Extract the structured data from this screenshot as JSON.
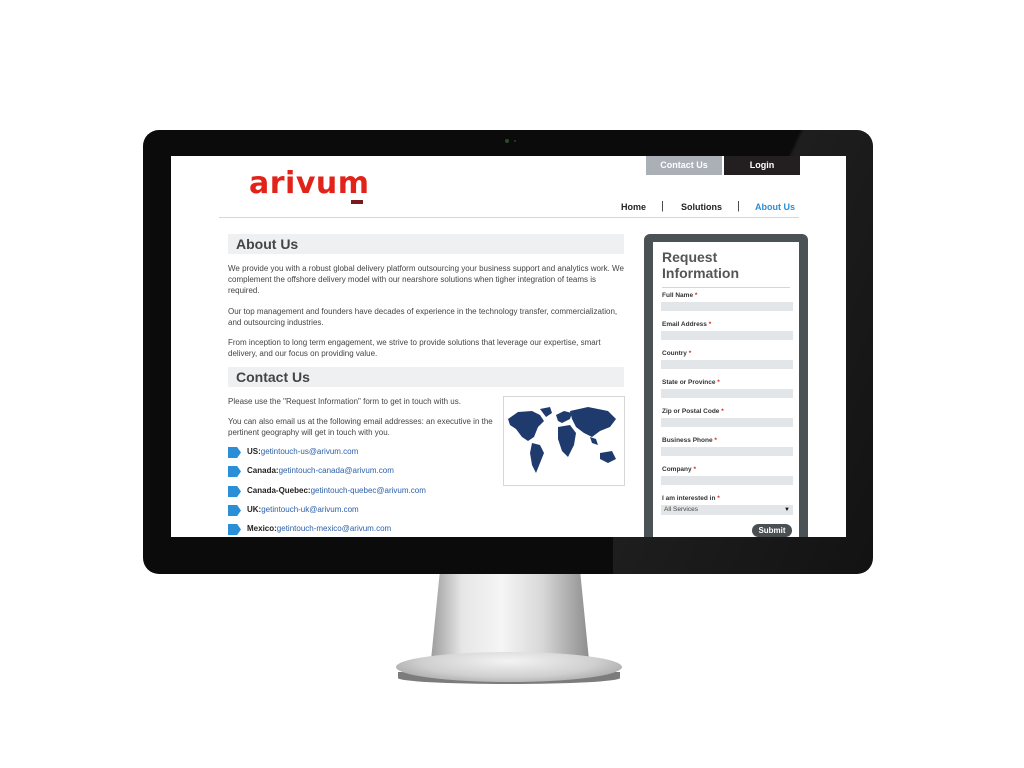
{
  "header": {
    "logo": "arivum",
    "contact_button": "Contact Us",
    "login_button": "Login",
    "nav": [
      {
        "label": "Home"
      },
      {
        "label": "Solutions"
      },
      {
        "label": "About Us"
      }
    ],
    "nav_separator": "|"
  },
  "about": {
    "title": "About Us",
    "paragraphs": [
      "We provide you with a robust global delivery platform outsourcing your business support and analytics work. We complement the offshore delivery model with our nearshore solutions when tigher integration of teams is required.",
      "Our top management and founders have decades of experience in the technology transfer, commercialization, and outsourcing industries.",
      "From inception to long term engagement, we strive to provide solutions that leverage our expertise, smart delivery, and our focus on providing value."
    ]
  },
  "contact": {
    "title": "Contact Us",
    "paragraphs": [
      "Please use the \"Request Information\" form to get in touch with us.",
      "You can also email us at the following email addresses: an executive in the pertinent geography will get in touch with you."
    ],
    "emails": [
      {
        "region": "US:",
        "email": "getintouch-us@arivum.com"
      },
      {
        "region": "Canada:",
        "email": "getintouch-canada@arivum.com"
      },
      {
        "region": "Canada-Quebec:",
        "email": "getintouch-quebec@arivum.com"
      },
      {
        "region": "UK:",
        "email": "getintouch-uk@arivum.com"
      },
      {
        "region": "Mexico:",
        "email": "getintouch-mexico@arivum.com"
      }
    ]
  },
  "form": {
    "title": "Request Information",
    "fields": [
      {
        "label": "Full Name",
        "required": "*"
      },
      {
        "label": "Email Address",
        "required": "*"
      },
      {
        "label": "Country",
        "required": "*"
      },
      {
        "label": "State or Province",
        "required": "*"
      },
      {
        "label": "Zip or Postal Code",
        "required": "*"
      },
      {
        "label": "Business Phone",
        "required": "*"
      },
      {
        "label": "Company",
        "required": "*"
      },
      {
        "label": "I am interested in",
        "required": "*"
      }
    ],
    "interest_selected": "All Services",
    "submit": "Submit"
  },
  "colors": {
    "brand_red": "#e2231a",
    "link_blue": "#2b5fa8",
    "nav_active": "#2a8fd6",
    "map_blue": "#1f3b6e"
  }
}
